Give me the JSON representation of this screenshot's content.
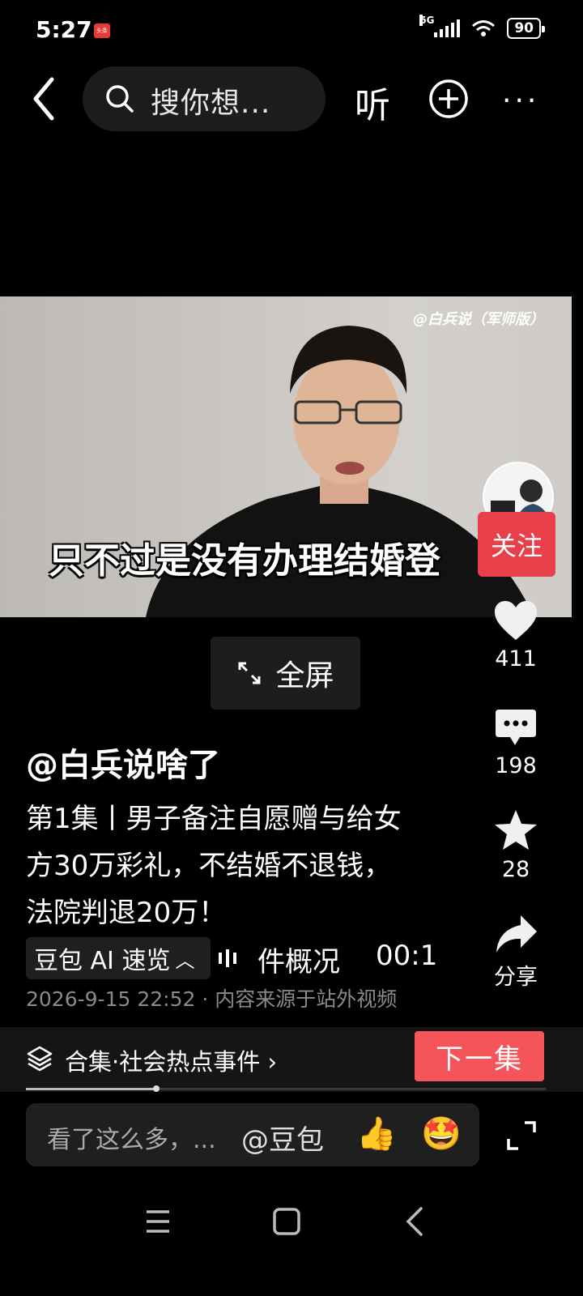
{
  "status_bar": {
    "time": "5:27",
    "app_badge": "头条",
    "network": "5G",
    "battery": "90"
  },
  "top_bar": {
    "search_placeholder": "搜你想...",
    "listen_label": "听"
  },
  "video": {
    "watermark": "@白兵说（军师版）",
    "subtitle": "只不过是没有办理结婚登",
    "fullscreen_label": "全屏"
  },
  "rail": {
    "follow_label": "关注",
    "like_count": "411",
    "comment_count": "198",
    "favorite_count": "28",
    "share_label": "分享"
  },
  "post": {
    "author": "@白兵说啥了",
    "description": "第1集丨男子备注自愿赠与给女方30万彩礼，不结婚不退钱，法院判退20万！",
    "ai_chip_label": "豆包 AI 速览",
    "ai_summary_text": "件概况",
    "ai_time": "00:1",
    "meta": "2026-9-15 22:52 · 内容来源于站外视频"
  },
  "collection": {
    "label": "合集·社会热点事件",
    "next_label": "下一集",
    "progress": 0.25
  },
  "comment": {
    "placeholder": "看了这么多，...",
    "mention": "@豆包",
    "emoji_1": "👍",
    "emoji_2": "🤩"
  },
  "colors": {
    "background": "#000000",
    "follow": "#e8404b",
    "next": "#f4545a",
    "panel": "#1c1c1c"
  }
}
